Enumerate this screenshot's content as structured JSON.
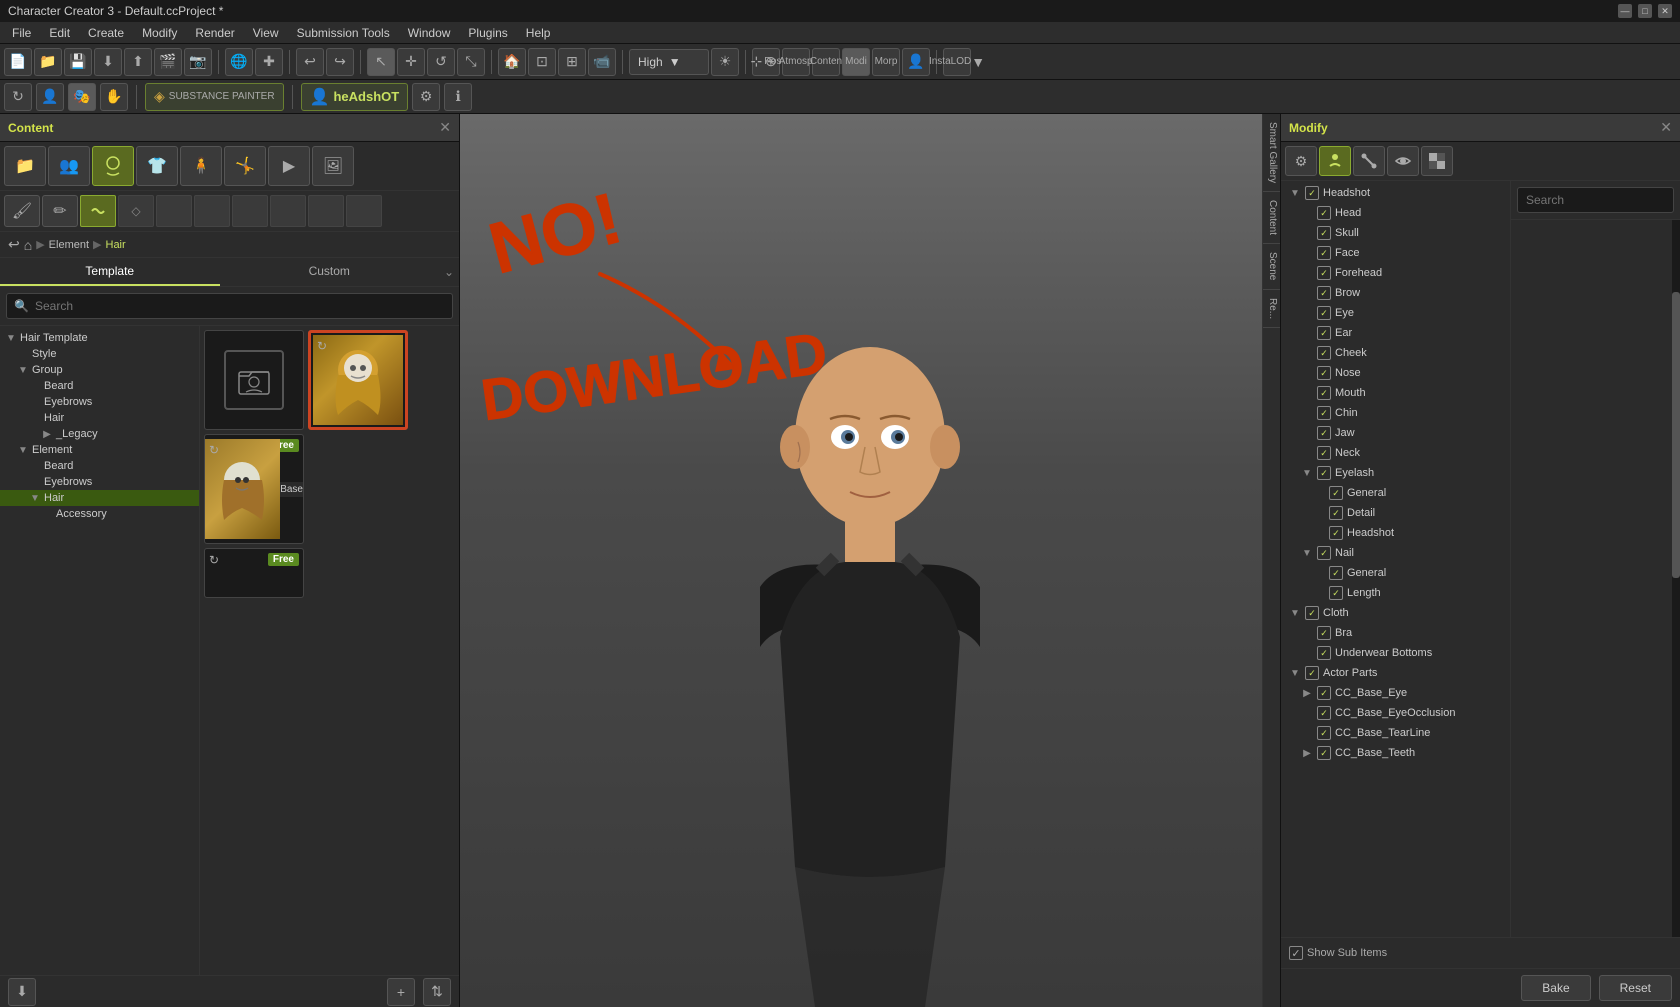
{
  "titlebar": {
    "title": "Character Creator 3 - Default.ccProject *",
    "minimize": "—",
    "maximize": "□",
    "close": "✕"
  },
  "menubar": {
    "items": [
      "File",
      "Edit",
      "Create",
      "Modify",
      "Render",
      "View",
      "Submission Tools",
      "Window",
      "Plugins",
      "Help"
    ]
  },
  "toolbar": {
    "quality": "High",
    "pos_label": "Pos",
    "atmosphere_label": "Atmospher",
    "content_label": "Conten",
    "modify_label": "Modi",
    "morph_label": "Morp",
    "instalod_label": "InstaLOD"
  },
  "secondary_toolbar": {
    "substance_label": "SUBSTANCE PAINTER",
    "headshot_label": "heAdshOT"
  },
  "content_panel": {
    "title": "Content",
    "tabs": [
      "Template",
      "Custom"
    ],
    "active_tab": 0,
    "search_placeholder": "Search",
    "breadcrumb": [
      "Element",
      "Hair"
    ],
    "tree": {
      "items": [
        {
          "label": "Hair Template",
          "level": 0,
          "expanded": true
        },
        {
          "label": "Style",
          "level": 1
        },
        {
          "label": "Group",
          "level": 1,
          "expanded": true
        },
        {
          "label": "Beard",
          "level": 2
        },
        {
          "label": "Eyebrows",
          "level": 2
        },
        {
          "label": "Hair",
          "level": 2
        },
        {
          "label": "_Legacy",
          "level": 3,
          "expanded": false
        },
        {
          "label": "Element",
          "level": 1,
          "expanded": true
        },
        {
          "label": "Beard",
          "level": 2
        },
        {
          "label": "Eyebrows",
          "level": 2
        },
        {
          "label": "Hair",
          "level": 2,
          "selected": true
        },
        {
          "label": "Accessory",
          "level": 3
        }
      ]
    },
    "grid_items": [
      {
        "label": "",
        "free": false,
        "placeholder": true
      },
      {
        "label": "",
        "free": true,
        "selected": true,
        "has_hair": true
      },
      {
        "label": "Base",
        "free": true,
        "has_hair2": true
      },
      {
        "label": "",
        "free": true,
        "partial": true
      }
    ]
  },
  "modify_panel": {
    "title": "Modify",
    "search_placeholder": "Search",
    "tree": [
      {
        "label": "Headshot",
        "level": 0,
        "expanded": true,
        "checked": true
      },
      {
        "label": "Head",
        "level": 1,
        "checked": true
      },
      {
        "label": "Skull",
        "level": 1,
        "checked": true
      },
      {
        "label": "Face",
        "level": 1,
        "checked": true
      },
      {
        "label": "Forehead",
        "level": 1,
        "checked": true
      },
      {
        "label": "Brow",
        "level": 1,
        "checked": true
      },
      {
        "label": "Eye",
        "level": 1,
        "checked": true
      },
      {
        "label": "Ear",
        "level": 1,
        "checked": true
      },
      {
        "label": "Cheek",
        "level": 1,
        "checked": true
      },
      {
        "label": "Nose",
        "level": 1,
        "checked": true
      },
      {
        "label": "Mouth",
        "level": 1,
        "checked": true
      },
      {
        "label": "Chin",
        "level": 1,
        "checked": true
      },
      {
        "label": "Jaw",
        "level": 1,
        "checked": true
      },
      {
        "label": "Neck",
        "level": 1,
        "checked": true
      },
      {
        "label": "Eyelash",
        "level": 1,
        "checked": true,
        "expanded": true
      },
      {
        "label": "General",
        "level": 2,
        "checked": true
      },
      {
        "label": "Detail",
        "level": 2,
        "checked": true
      },
      {
        "label": "Headshot",
        "level": 2,
        "checked": true
      },
      {
        "label": "Nail",
        "level": 1,
        "checked": true,
        "expanded": true
      },
      {
        "label": "General",
        "level": 2,
        "checked": true
      },
      {
        "label": "Length",
        "level": 2,
        "checked": true
      },
      {
        "label": "Cloth",
        "level": 1,
        "checked": true,
        "expanded": false
      },
      {
        "label": "Bra",
        "level": 2,
        "checked": true
      },
      {
        "label": "Underwear Bottoms",
        "level": 2,
        "checked": true
      },
      {
        "label": "Actor Parts",
        "level": 1,
        "checked": true,
        "expanded": true
      },
      {
        "label": "CC_Base_Eye",
        "level": 2,
        "checked": true
      },
      {
        "label": "CC_Base_EyeOcclusion",
        "level": 2,
        "checked": true
      },
      {
        "label": "CC_Base_TearLine",
        "level": 2,
        "checked": true
      },
      {
        "label": "CC_Base_Teeth",
        "level": 2,
        "checked": true
      }
    ],
    "show_sub_items": "Show Sub Items",
    "bake_label": "Bake",
    "reset_label": "Reset"
  },
  "annotation": {
    "no_text": "NO!",
    "download_text": "DOWNLOAD"
  },
  "side_tabs": [
    "Smart Gallery",
    "Content",
    "Scene",
    "Re..."
  ]
}
